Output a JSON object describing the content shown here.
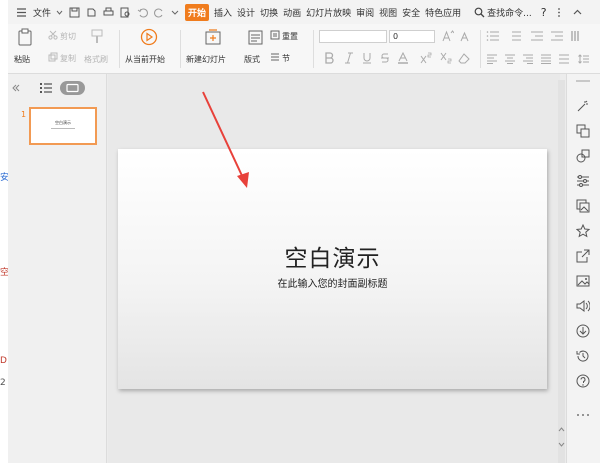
{
  "menu": {
    "file": "文件",
    "tabs": [
      "开始",
      "插入",
      "设计",
      "切换",
      "动画",
      "幻灯片放映",
      "审阅",
      "视图",
      "安全",
      "特色应用"
    ],
    "search": "查找命令...",
    "help": "?"
  },
  "ribbon": {
    "paste": "粘贴",
    "cut": "剪切",
    "copy": "复制",
    "format_painter": "格式刷",
    "from_current": "从当前开始",
    "new_slide": "新建幻灯片",
    "layout": "版式",
    "reset": "重置",
    "section": "节",
    "font_size": "0"
  },
  "left_panel": {
    "slide_number": "1",
    "thumb_title": "空白演示"
  },
  "slide": {
    "title": "空白演示",
    "subtitle": "在此输入您的封面副标题"
  },
  "bg_fragments": [
    "安",
    "空",
    "D",
    "2"
  ],
  "colors": {
    "accent": "#f07c1d",
    "arrow": "#e8413a"
  }
}
